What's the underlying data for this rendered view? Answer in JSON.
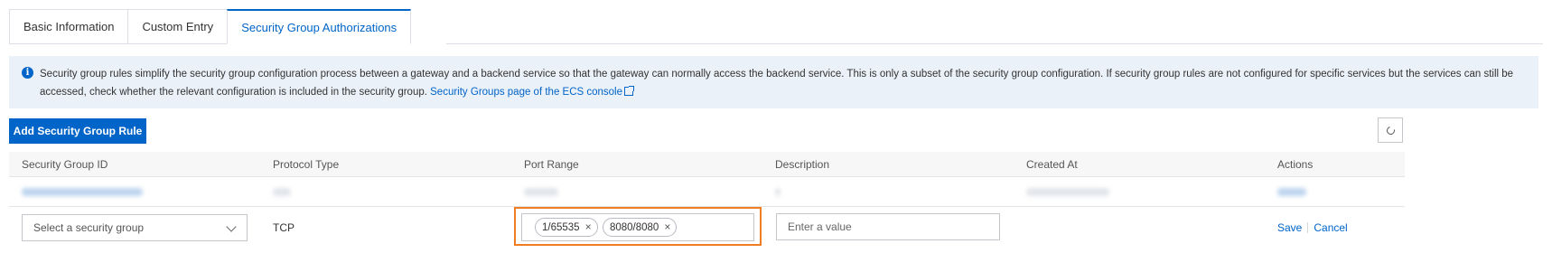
{
  "tabs": [
    {
      "label": "Basic Information",
      "active": false
    },
    {
      "label": "Custom Entry",
      "active": false
    },
    {
      "label": "Security Group Authorizations",
      "active": true
    }
  ],
  "notice": {
    "icon": "info-icon",
    "text": "Security group rules simplify the security group configuration process between a gateway and a backend service so that the gateway can normally access the backend service. This is only a subset of the security group configuration. If security group rules are not configured for specific services but the services can still be accessed, check whether the relevant configuration is included in the security group.",
    "link_text": "Security Groups page of the ECS console"
  },
  "toolbar": {
    "add_label": "Add Security Group Rule",
    "refresh_icon": "refresh-icon"
  },
  "table": {
    "columns": [
      "Security Group ID",
      "Protocol Type",
      "Port Range",
      "Description",
      "Created At",
      "Actions"
    ],
    "edit_row": {
      "select_placeholder": "Select a security group",
      "protocol": "TCP",
      "ports": [
        "1/65535",
        "8080/8080"
      ],
      "description_placeholder": "Enter a value",
      "save_label": "Save",
      "cancel_label": "Cancel"
    }
  },
  "colors": {
    "accent": "#0064c8",
    "highlight": "#ef7d22",
    "notice_bg": "#ebf1f8"
  }
}
